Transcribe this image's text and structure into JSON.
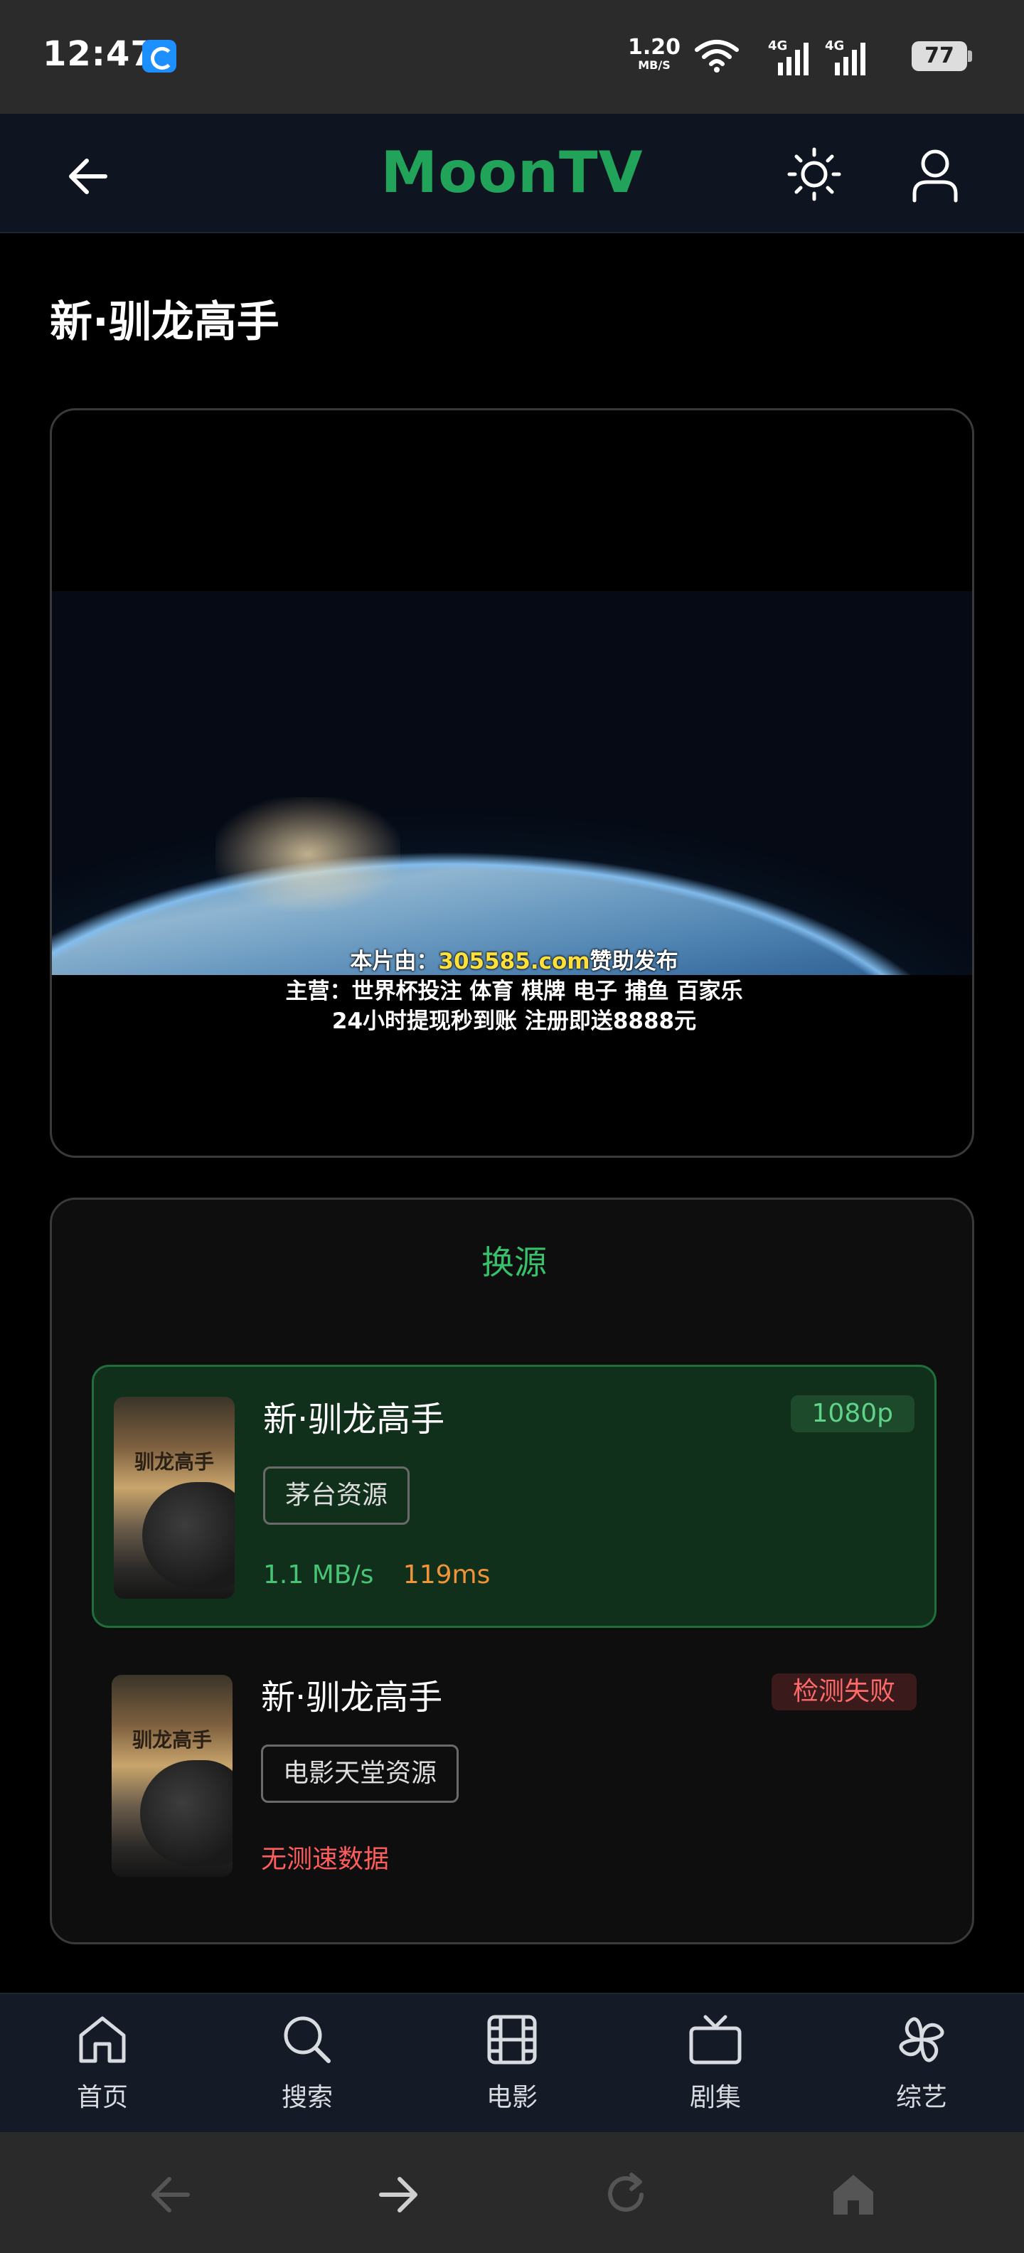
{
  "status_bar": {
    "time": "12:47",
    "net_speed_value": "1.20",
    "net_speed_unit": "MB/S",
    "signal_1_label": "4G",
    "signal_2_label": "4G",
    "battery": "77"
  },
  "header": {
    "brand": "MoonTV",
    "back_icon": "arrow-left-icon",
    "theme_icon": "sun-icon",
    "user_icon": "user-icon",
    "brand_color": "#22a35a"
  },
  "page": {
    "title": "新·驯龙高手"
  },
  "player": {
    "subtitle_prefix": "本片由：",
    "subtitle_site": "305585.com",
    "subtitle_suffix": "赞助发布",
    "subtitle_line2": "主营：世界杯投注 体育 棋牌 电子 捕鱼 百家乐",
    "subtitle_line3": "24小时提现秒到账 注册即送8888元"
  },
  "sources": {
    "title": "换源",
    "items": [
      {
        "name": "新·驯龙高手",
        "poster_text": "驯龙高手",
        "quality": "1080p",
        "source": "茅台资源",
        "speed": "1.1 MB/s",
        "ping": "119ms",
        "active": true
      },
      {
        "name": "新·驯龙高手",
        "poster_text": "驯龙高手",
        "quality": "检测失败",
        "source": "电影天堂资源",
        "no_data": "无测速数据",
        "active": false
      }
    ]
  },
  "bottom_nav": {
    "items": [
      {
        "label": "首页",
        "icon": "home-icon"
      },
      {
        "label": "搜索",
        "icon": "search-icon"
      },
      {
        "label": "电影",
        "icon": "film-icon"
      },
      {
        "label": "剧集",
        "icon": "tv-icon"
      },
      {
        "label": "综艺",
        "icon": "clover-icon"
      }
    ]
  },
  "system_nav": {
    "icons": [
      "back-icon",
      "forward-icon",
      "reload-icon",
      "home-icon"
    ]
  }
}
